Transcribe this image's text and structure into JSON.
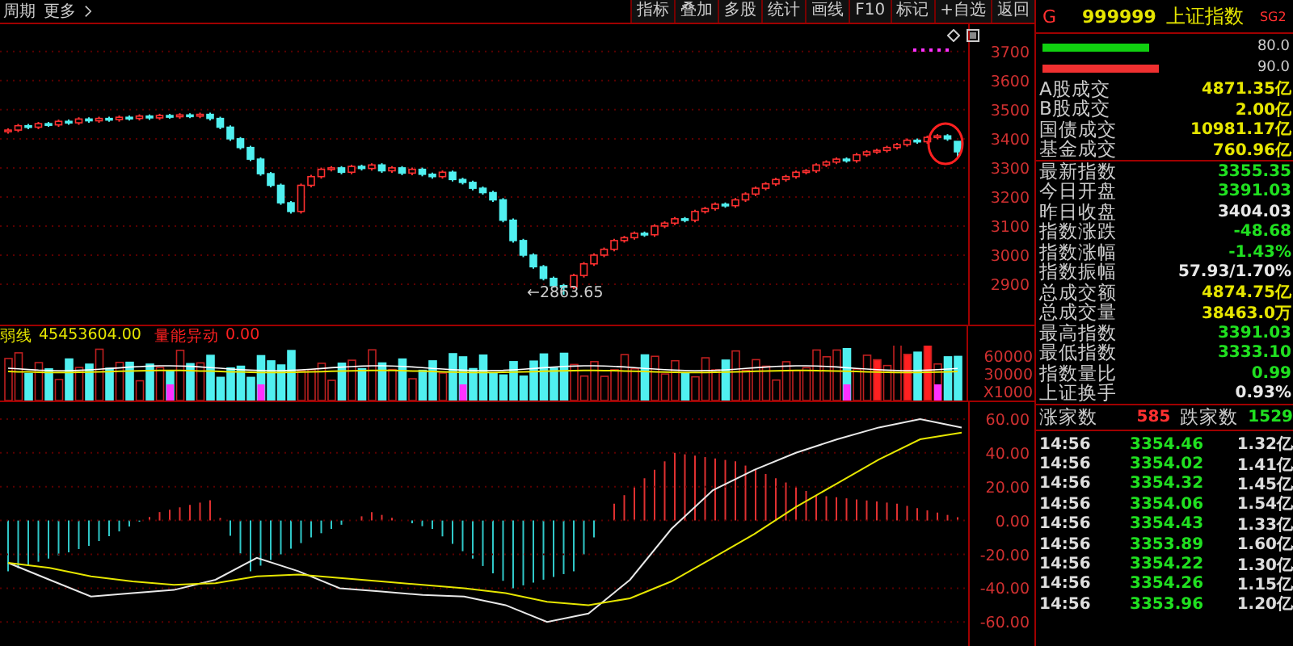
{
  "top_bar": {
    "left_items": [
      "周期",
      "更多"
    ],
    "tools": [
      "指标",
      "叠加",
      "多股",
      "统计",
      "画线",
      "F10",
      "标记",
      "+自选",
      "返回"
    ]
  },
  "price_chart": {
    "low_label": "←2863.65",
    "chart_data": {
      "type": "candlestick",
      "grid": true,
      "ylim": [
        2761,
        3794
      ],
      "yticks": [
        {
          "value": 3700,
          "label": "3700"
        },
        {
          "value": 3600,
          "label": "3600"
        },
        {
          "value": 3500,
          "label": "3500"
        },
        {
          "value": 3400,
          "label": "3400"
        },
        {
          "value": 3300,
          "label": "3300"
        },
        {
          "value": 3200,
          "label": "3200"
        },
        {
          "value": 3100,
          "label": "3100"
        },
        {
          "value": 3000,
          "label": "3000"
        },
        {
          "value": 2900,
          "label": "2900"
        }
      ],
      "ohlc": [
        [
          3425,
          3436,
          3418,
          3430
        ],
        [
          3430,
          3451,
          3423,
          3445
        ],
        [
          3445,
          3451,
          3433,
          3440
        ],
        [
          3440,
          3458,
          3433,
          3452
        ],
        [
          3452,
          3458,
          3441,
          3448
        ],
        [
          3448,
          3466,
          3441,
          3460
        ],
        [
          3460,
          3466,
          3448,
          3455
        ],
        [
          3455,
          3474,
          3448,
          3468
        ],
        [
          3468,
          3474,
          3455,
          3462
        ],
        [
          3462,
          3476,
          3455,
          3470
        ],
        [
          3470,
          3476,
          3459,
          3466
        ],
        [
          3466,
          3480,
          3459,
          3474
        ],
        [
          3474,
          3480,
          3463,
          3470
        ],
        [
          3470,
          3484,
          3463,
          3478
        ],
        [
          3478,
          3484,
          3465,
          3472
        ],
        [
          3472,
          3486,
          3465,
          3480
        ],
        [
          3480,
          3486,
          3469,
          3476
        ],
        [
          3476,
          3488,
          3469,
          3482
        ],
        [
          3482,
          3488,
          3471,
          3478
        ],
        [
          3478,
          3490,
          3471,
          3484
        ],
        [
          3484,
          3490,
          3463,
          3470
        ],
        [
          3470,
          3476,
          3433,
          3440
        ],
        [
          3440,
          3446,
          3393,
          3400
        ],
        [
          3400,
          3406,
          3363,
          3370
        ],
        [
          3370,
          3376,
          3323,
          3330
        ],
        [
          3330,
          3336,
          3273,
          3280
        ],
        [
          3280,
          3286,
          3233,
          3240
        ],
        [
          3240,
          3246,
          3173,
          3180
        ],
        [
          3180,
          3186,
          3143,
          3150
        ],
        [
          3150,
          3246,
          3143,
          3240
        ],
        [
          3240,
          3276,
          3233,
          3270
        ],
        [
          3270,
          3301,
          3263,
          3295
        ],
        [
          3295,
          3306,
          3288,
          3300
        ],
        [
          3300,
          3306,
          3278,
          3285
        ],
        [
          3285,
          3311,
          3278,
          3305
        ],
        [
          3305,
          3311,
          3291,
          3298
        ],
        [
          3298,
          3316,
          3291,
          3310
        ],
        [
          3310,
          3316,
          3283,
          3290
        ],
        [
          3290,
          3306,
          3283,
          3300
        ],
        [
          3300,
          3306,
          3275,
          3282
        ],
        [
          3282,
          3301,
          3275,
          3295
        ],
        [
          3295,
          3301,
          3271,
          3278
        ],
        [
          3278,
          3284,
          3263,
          3270
        ],
        [
          3270,
          3291,
          3263,
          3285
        ],
        [
          3285,
          3291,
          3253,
          3260
        ],
        [
          3260,
          3266,
          3243,
          3250
        ],
        [
          3250,
          3256,
          3223,
          3230
        ],
        [
          3230,
          3236,
          3208,
          3215
        ],
        [
          3215,
          3221,
          3183,
          3190
        ],
        [
          3190,
          3196,
          3113,
          3120
        ],
        [
          3120,
          3126,
          3043,
          3050
        ],
        [
          3050,
          3056,
          2993,
          3000
        ],
        [
          3000,
          3006,
          2953,
          2960
        ],
        [
          2960,
          2966,
          2913,
          2920
        ],
        [
          2920,
          2926,
          2888,
          2895
        ],
        [
          2895,
          2901,
          2863.65,
          2890
        ],
        [
          2890,
          2936,
          2883,
          2930
        ],
        [
          2930,
          2976,
          2923,
          2970
        ],
        [
          2970,
          3006,
          2963,
          3000
        ],
        [
          3000,
          3026,
          2993,
          3020
        ],
        [
          3020,
          3056,
          3013,
          3050
        ],
        [
          3050,
          3066,
          3043,
          3060
        ],
        [
          3060,
          3081,
          3053,
          3075
        ],
        [
          3075,
          3081,
          3063,
          3070
        ],
        [
          3070,
          3106,
          3063,
          3100
        ],
        [
          3100,
          3116,
          3093,
          3110
        ],
        [
          3110,
          3131,
          3103,
          3125
        ],
        [
          3125,
          3131,
          3113,
          3120
        ],
        [
          3120,
          3156,
          3113,
          3150
        ],
        [
          3150,
          3166,
          3143,
          3160
        ],
        [
          3160,
          3181,
          3153,
          3175
        ],
        [
          3175,
          3181,
          3163,
          3170
        ],
        [
          3170,
          3196,
          3163,
          3190
        ],
        [
          3190,
          3216,
          3183,
          3210
        ],
        [
          3210,
          3236,
          3203,
          3230
        ],
        [
          3230,
          3251,
          3223,
          3245
        ],
        [
          3245,
          3266,
          3238,
          3260
        ],
        [
          3260,
          3276,
          3253,
          3270
        ],
        [
          3270,
          3291,
          3263,
          3285
        ],
        [
          3285,
          3296,
          3278,
          3290
        ],
        [
          3290,
          3316,
          3283,
          3310
        ],
        [
          3310,
          3326,
          3303,
          3320
        ],
        [
          3320,
          3336,
          3313,
          3330
        ],
        [
          3330,
          3336,
          3318,
          3325
        ],
        [
          3325,
          3351,
          3318,
          3345
        ],
        [
          3345,
          3361,
          3338,
          3355
        ],
        [
          3355,
          3366,
          3348,
          3360
        ],
        [
          3360,
          3376,
          3353,
          3370
        ],
        [
          3370,
          3386,
          3363,
          3380
        ],
        [
          3380,
          3401,
          3373,
          3395
        ],
        [
          3395,
          3401,
          3383,
          3390
        ],
        [
          3390,
          3411,
          3383,
          3405
        ],
        [
          3405,
          3416,
          3398,
          3410
        ],
        [
          3410,
          3416,
          3393,
          3400
        ],
        [
          3391.03,
          3391.03,
          3333.1,
          3355.35
        ]
      ]
    }
  },
  "volume_chart": {
    "legend": [
      {
        "label": "弱线",
        "value": "45453604.00",
        "color": "#e6e600"
      },
      {
        "label": "量能异动",
        "value": "0.00",
        "color": "#ff2020"
      }
    ],
    "axis_labels": [
      "60000",
      "30000",
      "X1000"
    ]
  },
  "macd_chart": {
    "chart_data": {
      "type": "line",
      "grid": true,
      "ylim": [
        -78,
        70
      ],
      "yticks": [
        {
          "value": 60,
          "label": "60.00"
        },
        {
          "value": 40,
          "label": "40.00"
        },
        {
          "value": 20,
          "label": "20.00"
        },
        {
          "value": 0,
          "label": "0.00"
        },
        {
          "value": -20,
          "label": "-20.00"
        },
        {
          "value": -40,
          "label": "-40.00"
        },
        {
          "value": -60,
          "label": "-60.00"
        }
      ],
      "series": [
        {
          "color": "#e8e8e8",
          "values": [
            -25,
            -35,
            -45,
            -43,
            -41,
            -35,
            -22,
            -30,
            -40,
            -42,
            -44,
            -45,
            -50,
            -60,
            -55,
            -35,
            -5,
            18,
            30,
            40,
            48,
            55,
            60,
            55
          ]
        },
        {
          "color": "#e6e600",
          "values": [
            -25,
            -28,
            -33,
            -36,
            -38,
            -37,
            -33,
            -32,
            -34,
            -36,
            -38,
            -40,
            -43,
            -48,
            -50,
            -46,
            -36,
            -22,
            -8,
            8,
            22,
            36,
            48,
            52
          ]
        }
      ]
    }
  },
  "quote_panel": {
    "prefix": "G",
    "code": "999999",
    "name": "上证指数",
    "tag": "SG2",
    "bars": [
      {
        "color": "#10d010",
        "reading": "80.0"
      },
      {
        "color": "#f03030",
        "reading": "90.0"
      }
    ],
    "turnover": [
      {
        "label": "A股成交",
        "value": "4871.35亿"
      },
      {
        "label": "B股成交",
        "value": "2.00亿"
      },
      {
        "label": "国债成交",
        "value": "10981.17亿"
      },
      {
        "label": "基金成交",
        "value": "760.96亿"
      }
    ],
    "stats": [
      {
        "label": "最新指数",
        "value": "3355.35",
        "color": "#20e020"
      },
      {
        "label": "今日开盘",
        "value": "3391.03",
        "color": "#20e020"
      },
      {
        "label": "昨日收盘",
        "value": "3404.03",
        "color": "#e8e8e8"
      },
      {
        "label": "指数涨跌",
        "value": "-48.68",
        "color": "#20e020"
      },
      {
        "label": "指数涨幅",
        "value": "-1.43%",
        "color": "#20e020"
      },
      {
        "label": "指数振幅",
        "value": "57.93/1.70%",
        "color": "#e8e8e8"
      },
      {
        "label": "总成交额",
        "value": "4874.75亿",
        "color": "#e6e600"
      },
      {
        "label": "总成交量",
        "value": "38463.0万",
        "color": "#e6e600"
      },
      {
        "label": "最高指数",
        "value": "3391.03",
        "color": "#20e020"
      },
      {
        "label": "最低指数",
        "value": "3333.10",
        "color": "#20e020"
      },
      {
        "label": "指数量比",
        "value": "0.99",
        "color": "#20e020"
      },
      {
        "label": "上证换手",
        "value": "0.93%",
        "color": "#e8e8e8"
      }
    ],
    "breadth": {
      "up_label": "涨家数",
      "up": "585",
      "down_label": "跌家数",
      "down": "1529"
    },
    "ticks": [
      {
        "time": "14:56",
        "price": "3354.46",
        "amount": "1.32亿"
      },
      {
        "time": "14:56",
        "price": "3354.02",
        "amount": "1.41亿"
      },
      {
        "time": "14:56",
        "price": "3354.32",
        "amount": "1.45亿"
      },
      {
        "time": "14:56",
        "price": "3354.06",
        "amount": "1.54亿"
      },
      {
        "time": "14:56",
        "price": "3354.43",
        "amount": "1.33亿"
      },
      {
        "time": "14:56",
        "price": "3353.89",
        "amount": "1.60亿"
      },
      {
        "time": "14:56",
        "price": "3354.22",
        "amount": "1.30亿"
      },
      {
        "time": "14:56",
        "price": "3354.26",
        "amount": "1.15亿"
      },
      {
        "time": "14:56",
        "price": "3353.96",
        "amount": "1.20亿"
      }
    ]
  }
}
